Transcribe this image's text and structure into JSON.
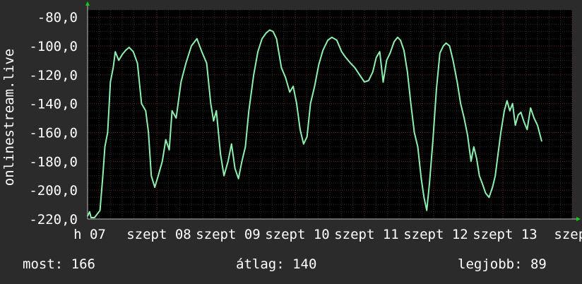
{
  "chart_data": {
    "type": "line",
    "ylabel": "onlinestream.live",
    "ylim": [
      -220,
      -75
    ],
    "yticks": [
      -80,
      -100,
      -120,
      -140,
      -160,
      -180,
      -200,
      -220
    ],
    "ytick_labels": [
      "-80,0",
      "-100,0",
      "-120,0",
      "-140,0",
      "-160,0",
      "-180,0",
      "-200,0",
      "-220,0"
    ],
    "xlim": [
      0,
      7
    ],
    "xticks": [
      0,
      1,
      2,
      3,
      4,
      5,
      6,
      7
    ],
    "xtick_labels": [
      "h 07",
      "szept 08",
      "szept 09",
      "szept 10",
      "szept 11",
      "szept 12",
      "szept 13",
      "szept"
    ],
    "grid": true,
    "line_color": "#8ef0b0",
    "series": [
      {
        "values": [
          [
            0.0,
            -218
          ],
          [
            0.03,
            -215
          ],
          [
            0.05,
            -219
          ],
          [
            0.1,
            -219
          ],
          [
            0.18,
            -214
          ],
          [
            0.22,
            -190
          ],
          [
            0.25,
            -170
          ],
          [
            0.29,
            -160
          ],
          [
            0.33,
            -125
          ],
          [
            0.37,
            -115
          ],
          [
            0.4,
            -104
          ],
          [
            0.45,
            -110
          ],
          [
            0.5,
            -106
          ],
          [
            0.55,
            -103
          ],
          [
            0.6,
            -101
          ],
          [
            0.66,
            -104
          ],
          [
            0.72,
            -112
          ],
          [
            0.78,
            -140
          ],
          [
            0.84,
            -145
          ],
          [
            0.88,
            -160
          ],
          [
            0.92,
            -190
          ],
          [
            0.97,
            -198
          ],
          [
            1.02,
            -190
          ],
          [
            1.08,
            -180
          ],
          [
            1.13,
            -165
          ],
          [
            1.18,
            -172
          ],
          [
            1.22,
            -145
          ],
          [
            1.28,
            -150
          ],
          [
            1.35,
            -125
          ],
          [
            1.42,
            -112
          ],
          [
            1.5,
            -100
          ],
          [
            1.58,
            -95
          ],
          [
            1.65,
            -104
          ],
          [
            1.72,
            -112
          ],
          [
            1.78,
            -140
          ],
          [
            1.82,
            -152
          ],
          [
            1.86,
            -145
          ],
          [
            1.92,
            -175
          ],
          [
            1.97,
            -190
          ],
          [
            2.03,
            -180
          ],
          [
            2.08,
            -168
          ],
          [
            2.13,
            -185
          ],
          [
            2.18,
            -192
          ],
          [
            2.23,
            -180
          ],
          [
            2.28,
            -170
          ],
          [
            2.33,
            -145
          ],
          [
            2.4,
            -120
          ],
          [
            2.46,
            -104
          ],
          [
            2.52,
            -95
          ],
          [
            2.58,
            -91
          ],
          [
            2.63,
            -89
          ],
          [
            2.68,
            -90
          ],
          [
            2.73,
            -95
          ],
          [
            2.8,
            -115
          ],
          [
            2.86,
            -122
          ],
          [
            2.92,
            -132
          ],
          [
            2.97,
            -128
          ],
          [
            3.02,
            -140
          ],
          [
            3.07,
            -158
          ],
          [
            3.12,
            -168
          ],
          [
            3.17,
            -163
          ],
          [
            3.22,
            -140
          ],
          [
            3.28,
            -128
          ],
          [
            3.34,
            -113
          ],
          [
            3.4,
            -103
          ],
          [
            3.47,
            -96
          ],
          [
            3.53,
            -94
          ],
          [
            3.6,
            -96
          ],
          [
            3.67,
            -104
          ],
          [
            3.73,
            -108
          ],
          [
            3.8,
            -112
          ],
          [
            3.86,
            -115
          ],
          [
            3.93,
            -120
          ],
          [
            4.0,
            -125
          ],
          [
            4.06,
            -124
          ],
          [
            4.12,
            -118
          ],
          [
            4.17,
            -108
          ],
          [
            4.22,
            -104
          ],
          [
            4.27,
            -125
          ],
          [
            4.32,
            -110
          ],
          [
            4.37,
            -105
          ],
          [
            4.43,
            -97
          ],
          [
            4.48,
            -94
          ],
          [
            4.52,
            -96
          ],
          [
            4.57,
            -103
          ],
          [
            4.62,
            -118
          ],
          [
            4.67,
            -140
          ],
          [
            4.72,
            -160
          ],
          [
            4.77,
            -170
          ],
          [
            4.82,
            -192
          ],
          [
            4.86,
            -205
          ],
          [
            4.9,
            -214
          ],
          [
            4.94,
            -195
          ],
          [
            4.99,
            -165
          ],
          [
            5.04,
            -130
          ],
          [
            5.09,
            -105
          ],
          [
            5.14,
            -100
          ],
          [
            5.18,
            -98
          ],
          [
            5.23,
            -100
          ],
          [
            5.28,
            -110
          ],
          [
            5.34,
            -125
          ],
          [
            5.39,
            -140
          ],
          [
            5.44,
            -150
          ],
          [
            5.49,
            -162
          ],
          [
            5.54,
            -180
          ],
          [
            5.58,
            -170
          ],
          [
            5.62,
            -178
          ],
          [
            5.66,
            -190
          ],
          [
            5.7,
            -195
          ],
          [
            5.75,
            -202
          ],
          [
            5.8,
            -205
          ],
          [
            5.85,
            -198
          ],
          [
            5.89,
            -190
          ],
          [
            5.93,
            -175
          ],
          [
            5.97,
            -160
          ],
          [
            6.02,
            -145
          ],
          [
            6.06,
            -138
          ],
          [
            6.1,
            -145
          ],
          [
            6.14,
            -140
          ],
          [
            6.18,
            -155
          ],
          [
            6.22,
            -148
          ],
          [
            6.26,
            -146
          ],
          [
            6.3,
            -152
          ],
          [
            6.35,
            -158
          ],
          [
            6.4,
            -143
          ],
          [
            6.45,
            -150
          ],
          [
            6.5,
            -155
          ],
          [
            6.56,
            -166
          ]
        ]
      }
    ]
  },
  "stats": {
    "now": "most: 166",
    "avg": "átlag: 140",
    "best": "legjobb: 89"
  }
}
